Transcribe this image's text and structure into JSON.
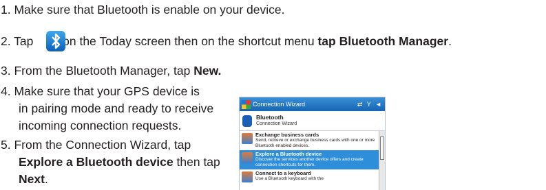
{
  "steps": [
    {
      "num": "1.",
      "text": "Make sure that Bluetooth is enable on your device."
    },
    {
      "num": "2.",
      "pre": "Tap",
      "post": "on the Today screen then on the shortcut menu",
      "bold": "tap Bluetooth Manager",
      "end": "."
    },
    {
      "num": "3.",
      "text": "From the Bluetooth Manager, tap",
      "bold": "New."
    },
    {
      "num": "4.",
      "lines": [
        "Make sure that your GPS device is",
        "in pairing mode and ready to receive",
        "incoming connection requests."
      ]
    },
    {
      "num": "5.",
      "line1": "From the Connection Wizard, tap",
      "bold": "Explore a Bluetooth device",
      "mid": "then tap",
      "bold2": "Next",
      "end": "."
    }
  ],
  "icons": {
    "inline": "bluetooth-icon"
  },
  "pda": {
    "title": "Connection Wizard",
    "status_icons": "⇄ Y ◄",
    "header_title": "Bluetooth",
    "header_sub": "Connection Wizard",
    "items": [
      {
        "title": "Exchange business cards",
        "desc": "Send, retrieve or exchange business cards with one or more Bluetooth enabled devices."
      },
      {
        "title": "Explore a Bluetooth device",
        "desc": "Discover the services another device offers and create connection shortcuts for them."
      },
      {
        "title": "Connect to a keyboard",
        "desc": "Use a Bluetooth keyboard with the"
      }
    ],
    "selected_index": 1
  }
}
